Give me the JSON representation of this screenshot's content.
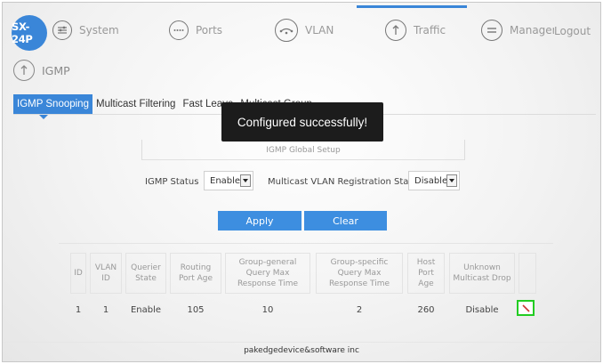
{
  "brand": "SX-24P",
  "nav": [
    {
      "label": "System",
      "icon": "sliders-icon"
    },
    {
      "label": "Ports",
      "icon": "ports-icon"
    },
    {
      "label": "VLAN",
      "icon": "vlan-icon"
    },
    {
      "label": "Traffic",
      "icon": "arrow-up-icon"
    },
    {
      "label": "Management",
      "icon": "menu-icon"
    }
  ],
  "logout": "Logout",
  "section_title": "IGMP",
  "tabs": [
    "IGMP Snooping",
    "Multicast Filtering",
    "Fast Leave",
    "Multicast Group"
  ],
  "toast": "Configured successfully!",
  "global_setup": {
    "title": "IGMP Global Setup",
    "igmp_status_label": "IGMP Status",
    "igmp_status_value": "Enable",
    "mvr_label": "Multicast VLAN Registration Status",
    "mvr_value": "Disable",
    "apply_label": "Apply",
    "clear_label": "Clear"
  },
  "table": {
    "headers": [
      "ID",
      "VLAN ID",
      "Querier State",
      "Routing Port Age",
      "Group-general Query Max Response Time",
      "Group-specific Query Max Response Time",
      "Host Port Age",
      "Unknown Multicast Drop",
      ""
    ],
    "rows": [
      [
        "1",
        "1",
        "Enable",
        "105",
        "10",
        "2",
        "260",
        "Disable"
      ]
    ]
  },
  "footer": "pakedgedevice&software inc",
  "colors": {
    "accent": "#3a86d8",
    "edit_highlight": "#22cc22",
    "edit_icon": "#cc3333"
  }
}
